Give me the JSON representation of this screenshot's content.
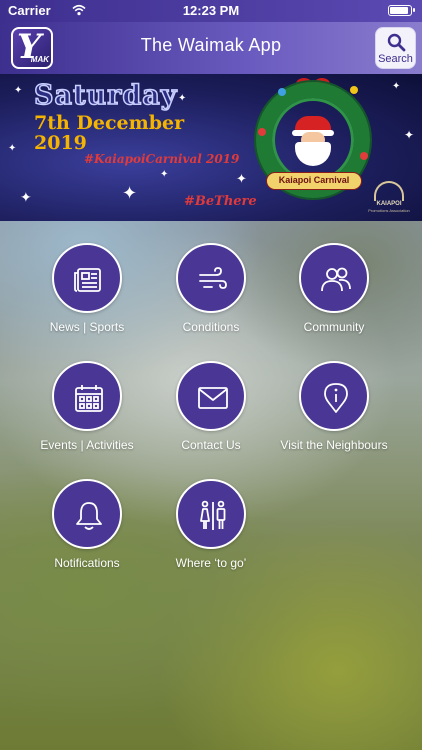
{
  "status_bar": {
    "carrier": "Carrier",
    "time": "12:23 PM"
  },
  "nav": {
    "title": "The Waimak App",
    "search_label": "Search",
    "logo_letter": "Y",
    "logo_sub": "MAK"
  },
  "banner": {
    "day": "Saturday",
    "date_line1": "7th December",
    "date_line2": "2019",
    "hashtag1": "#KaiapoiCarnival 2019",
    "hashtag2": "#BeThere",
    "wreath_label": "Kaiapoi Carnival",
    "corner_logo": "KAIAPOI",
    "corner_sub": "Promotions Association"
  },
  "menu": [
    {
      "label": "News | Sports",
      "icon": "newspaper-icon"
    },
    {
      "label": "Conditions",
      "icon": "wind-icon"
    },
    {
      "label": "Community",
      "icon": "people-icon"
    },
    {
      "label": "Events | Activities",
      "icon": "calendar-icon"
    },
    {
      "label": "Contact Us",
      "icon": "envelope-icon"
    },
    {
      "label": "Visit the Neighbours",
      "icon": "info-pin-icon"
    },
    {
      "label": "Notifications",
      "icon": "bell-icon"
    },
    {
      "label": "Where ‘to go’",
      "icon": "restroom-icon"
    }
  ],
  "colors": {
    "brand_purple": "#4a3795",
    "nav_gradient_start": "#3d2f8e",
    "banner_gold": "#f5b400",
    "banner_red": "#e13a3a"
  }
}
